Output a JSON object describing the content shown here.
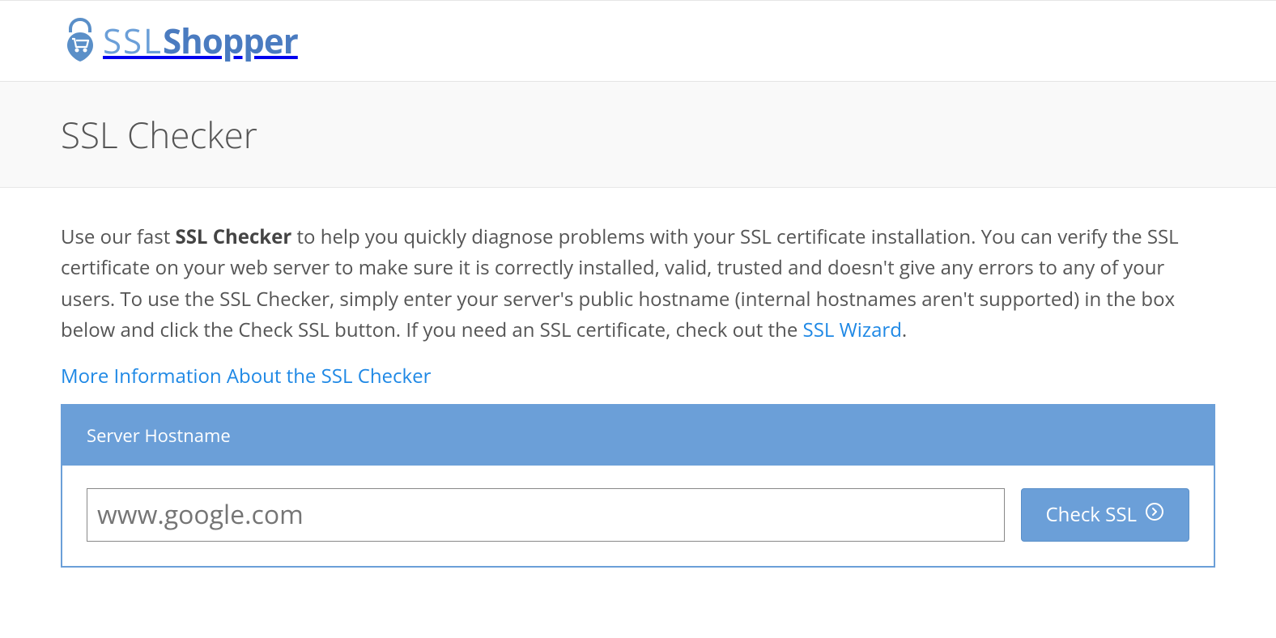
{
  "logo": {
    "ssl": "SSL",
    "shopper": "Shopper"
  },
  "page_title": "SSL Checker",
  "description": {
    "part1": "Use our fast ",
    "bold": "SSL Checker",
    "part2": " to help you quickly diagnose problems with your SSL certificate installation. You can verify the SSL certificate on your web server to make sure it is correctly installed, valid, trusted and doesn't give any errors to any of your users. To use the SSL Checker, simply enter your server's public hostname (internal hostnames aren't supported) in the box below and click the Check SSL button. If you need an SSL certificate, check out the ",
    "link_text": "SSL Wizard",
    "part3": "."
  },
  "more_info_link": "More Information About the SSL Checker",
  "form": {
    "header": "Server Hostname",
    "input_placeholder": "www.google.com",
    "input_value": "",
    "button_label": "Check SSL"
  }
}
